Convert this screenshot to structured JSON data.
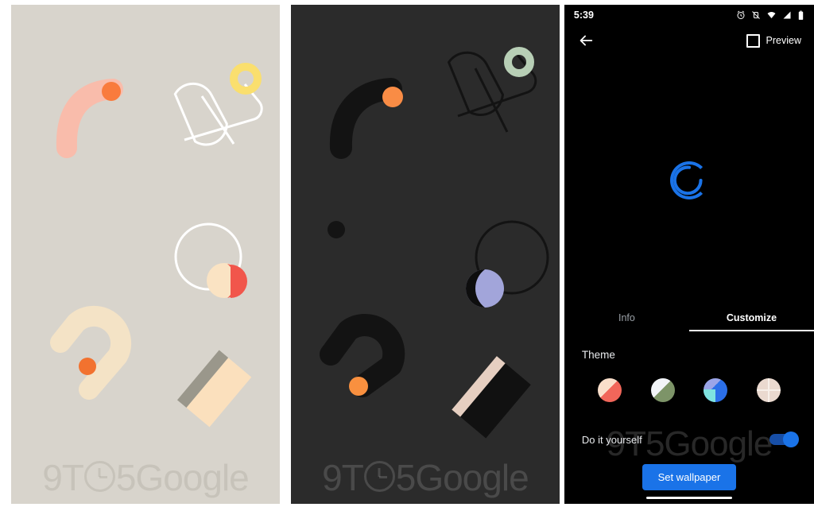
{
  "wallpaper_light": {
    "name": "light-wallpaper-preview",
    "background": "#d8d4cc",
    "watermark": "9T5Google",
    "shapes": [
      {
        "id": "arc-salmon",
        "color": "#f9bcab"
      },
      {
        "id": "dot-orange-top",
        "color": "#f97b3d"
      },
      {
        "id": "loop-outline-white",
        "color": "#ffffff"
      },
      {
        "id": "ring-yellow",
        "color": "#fadf6e"
      },
      {
        "id": "circle-outline-white",
        "color": "#ffffff"
      },
      {
        "id": "disc-cream",
        "color": "#fae3c3"
      },
      {
        "id": "disc-red",
        "color": "#f1564b"
      },
      {
        "id": "hook-cream",
        "color": "#f4e3c6"
      },
      {
        "id": "dot-orange-bottom",
        "color": "#f2722f"
      },
      {
        "id": "bar-cream",
        "color": "#fbe0bd"
      },
      {
        "id": "bar-grey",
        "color": "#9a978b"
      }
    ]
  },
  "wallpaper_dark": {
    "name": "dark-wallpaper-preview",
    "background": "#2b2b2b",
    "watermark": "9T5Google",
    "shapes": [
      {
        "id": "arc-black",
        "color": "#131313"
      },
      {
        "id": "dot-orange-top",
        "color": "#f98c45"
      },
      {
        "id": "loop-outline-black",
        "color": "#131313"
      },
      {
        "id": "ring-sage",
        "color": "#b8cfb6"
      },
      {
        "id": "circle-outline-black",
        "color": "#131313"
      },
      {
        "id": "disc-periwinkle",
        "color": "#a2a5da"
      },
      {
        "id": "disc-black",
        "color": "#0e0e0e"
      },
      {
        "id": "hook-black",
        "color": "#131313"
      },
      {
        "id": "dot-orange-bottom",
        "color": "#f9903f"
      },
      {
        "id": "bar-black",
        "color": "#111111"
      },
      {
        "id": "bar-blush",
        "color": "#e6cfc1"
      },
      {
        "id": "dot-small-black",
        "color": "#141414"
      }
    ]
  },
  "phone": {
    "statusbar": {
      "time": "5:39",
      "icons": [
        "alarm-icon",
        "vibrate-off-icon",
        "wifi-icon",
        "signal-icon",
        "battery-icon"
      ]
    },
    "appbar": {
      "back_label": "back-arrow-icon",
      "preview_label": "Preview",
      "preview_checked": false
    },
    "preview": {
      "loading": true,
      "spinner_color": "#1a73e8"
    },
    "tabs": [
      {
        "id": "tab-info",
        "label": "Info",
        "active": false
      },
      {
        "id": "tab-customize",
        "label": "Customize",
        "active": true
      }
    ],
    "theme_section": {
      "title": "Theme",
      "swatches": [
        {
          "id": "theme-swatch-salmon",
          "primary": "#f1665a",
          "secondary": "#fadfcb"
        },
        {
          "id": "theme-swatch-sage",
          "primary": "#7d9468",
          "secondary": "#dde4f3"
        },
        {
          "id": "theme-swatch-blue",
          "primary": "#2b6fe8",
          "secondary": "#9aa4e8"
        },
        {
          "id": "theme-swatch-neutral",
          "primary": "#ead9cf",
          "secondary": "#f4e9e2"
        }
      ]
    },
    "diy": {
      "label": "Do it yourself",
      "enabled": true,
      "accent": "#1a73e8"
    },
    "cta": {
      "label": "Set wallpaper",
      "color": "#1a73e8"
    },
    "navbar": {
      "label": "home-pill"
    },
    "watermark": "9T5Google"
  }
}
